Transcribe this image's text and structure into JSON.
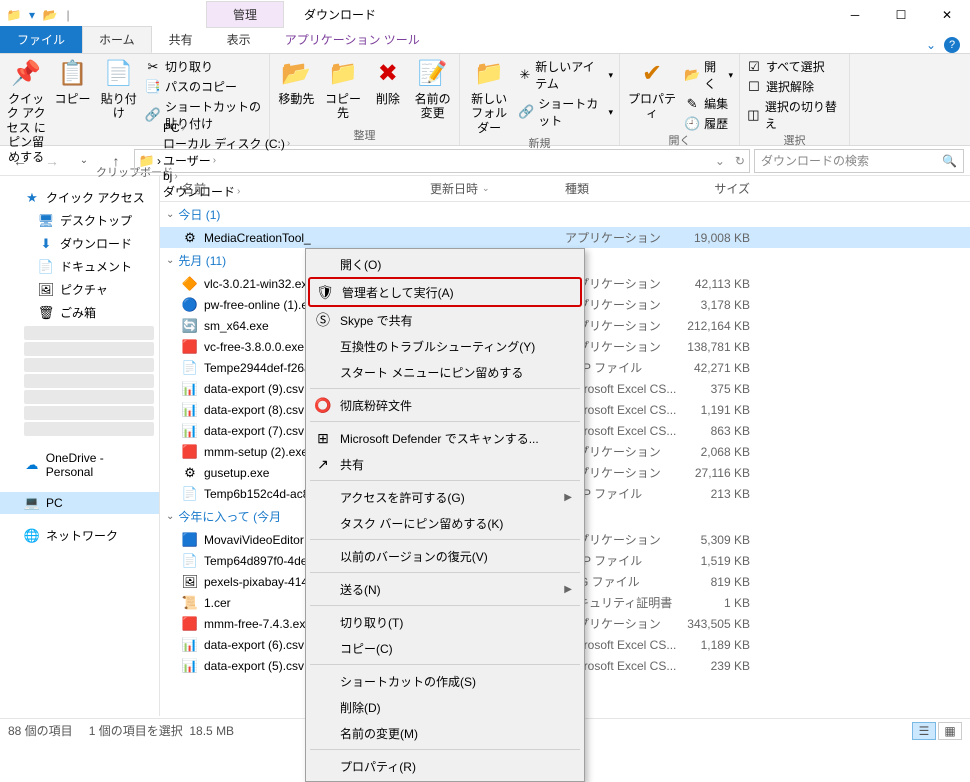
{
  "titlebar": {
    "manage_tab": "管理",
    "title": "ダウンロード"
  },
  "tabs": {
    "file": "ファイル",
    "home": "ホーム",
    "share": "共有",
    "view": "表示",
    "app": "アプリケーション ツール"
  },
  "ribbon": {
    "g1": {
      "pin": "クイック アクセス\nにピン留めする",
      "copy": "コピー",
      "paste": "貼り付け",
      "cut": "切り取り",
      "copypath": "パスのコピー",
      "pastesc": "ショートカットの貼り付け",
      "label": "クリップボード"
    },
    "g2": {
      "move": "移動先",
      "copyto": "コピー先",
      "delete": "削除",
      "rename": "名前の\n変更",
      "label": "整理"
    },
    "g3": {
      "newfolder": "新しい\nフォルダー",
      "newitem": "新しいアイテム",
      "shortcut": "ショートカット",
      "label": "新規"
    },
    "g4": {
      "props": "プロパティ",
      "open": "開く",
      "edit": "編集",
      "history": "履歴",
      "label": "開く"
    },
    "g5": {
      "selall": "すべて選択",
      "selnone": "選択解除",
      "selinv": "選択の切り替え",
      "label": "選択"
    }
  },
  "crumbs": [
    "PC",
    "ローカル ディスク (C:)",
    "ユーザー",
    "bj",
    "ダウンロード"
  ],
  "search_ph": "ダウンロードの検索",
  "cols": {
    "name": "名前",
    "date": "更新日時",
    "type": "種類",
    "size": "サイズ"
  },
  "sidebar": {
    "quick": "クイック アクセス",
    "desktop": "デスクトップ",
    "downloads": "ダウンロード",
    "documents": "ドキュメント",
    "pictures": "ピクチャ",
    "trash": "ごみ箱",
    "onedrive": "OneDrive - Personal",
    "pc": "PC",
    "network": "ネットワーク"
  },
  "groups": {
    "today": {
      "label": "今日",
      "count": "(1)"
    },
    "lastmonth": {
      "label": "先月",
      "count": "(11)"
    },
    "thisyear": {
      "label": "今年に入って (今月",
      "count": ""
    }
  },
  "files": {
    "today": [
      {
        "n": "MediaCreationTool_",
        "t": "アプリケーション",
        "s": "19,008 KB",
        "ic": "⚙",
        "sel": true
      }
    ],
    "lastmonth": [
      {
        "n": "vlc-3.0.21-win32.ex",
        "t": "アプリケーション",
        "s": "42,113 KB",
        "ic": "🔶"
      },
      {
        "n": "pw-free-online (1).e",
        "t": "アプリケーション",
        "s": "3,178 KB",
        "ic": "🔵"
      },
      {
        "n": "sm_x64.exe",
        "t": "アプリケーション",
        "s": "212,164 KB",
        "ic": "🔄"
      },
      {
        "n": "vc-free-3.8.0.0.exe",
        "t": "アプリケーション",
        "s": "138,781 KB",
        "ic": "🟥"
      },
      {
        "n": "Tempe2944def-f26a",
        "t": "EMP ファイル",
        "s": "42,271 KB",
        "ic": "📄"
      },
      {
        "n": "data-export (9).csv",
        "t": "Microsoft Excel CS...",
        "s": "375 KB",
        "ic": "📊"
      },
      {
        "n": "data-export (8).csv",
        "t": "Microsoft Excel CS...",
        "s": "1,191 KB",
        "ic": "📊"
      },
      {
        "n": "data-export (7).csv",
        "t": "Microsoft Excel CS...",
        "s": "863 KB",
        "ic": "📊"
      },
      {
        "n": "mmm-setup (2).exe",
        "t": "アプリケーション",
        "s": "2,068 KB",
        "ic": "🟥"
      },
      {
        "n": "gusetup.exe",
        "t": "アプリケーション",
        "s": "27,116 KB",
        "ic": "⚙"
      },
      {
        "n": "Temp6b152c4d-ac8",
        "t": "EMP ファイル",
        "s": "213 KB",
        "ic": "📄"
      }
    ],
    "thisyear": [
      {
        "n": "MovaviVideoEditor",
        "t": "アプリケーション",
        "s": "5,309 KB",
        "ic": "🟦"
      },
      {
        "n": "Temp64d897f0-4de2",
        "t": "EMP ファイル",
        "s": "1,519 KB",
        "ic": "📄"
      },
      {
        "n": "pexels-pixabay-414",
        "t": "JPG ファイル",
        "s": "819 KB",
        "ic": "🖼"
      },
      {
        "n": "1.cer",
        "t": "セキュリティ証明書",
        "s": "1 KB",
        "ic": "📜"
      },
      {
        "n": "mmm-free-7.4.3.exe",
        "t": "アプリケーション",
        "s": "343,505 KB",
        "ic": "🟥"
      },
      {
        "n": "data-export (6).csv",
        "t": "Microsoft Excel CS...",
        "s": "1,189 KB",
        "ic": "📊"
      },
      {
        "n": "data-export (5).csv",
        "t": "Microsoft Excel CS...",
        "s": "239 KB",
        "ic": "📊"
      }
    ]
  },
  "context": [
    {
      "l": "開く(O)",
      "ic": ""
    },
    {
      "l": "管理者として実行(A)",
      "ic": "🛡",
      "hl": true
    },
    {
      "l": "Skype で共有",
      "ic": "Ⓢ"
    },
    {
      "l": "互換性のトラブルシューティング(Y)",
      "ic": ""
    },
    {
      "l": "スタート メニューにピン留めする",
      "ic": ""
    },
    {
      "sep": true
    },
    {
      "l": "彻底粉碎文件",
      "ic": "⭕"
    },
    {
      "sep": true
    },
    {
      "l": "Microsoft Defender でスキャンする...",
      "ic": "⊞"
    },
    {
      "l": "共有",
      "ic": "↗"
    },
    {
      "sep": true
    },
    {
      "l": "アクセスを許可する(G)",
      "sub": true
    },
    {
      "l": "タスク バーにピン留めする(K)"
    },
    {
      "sep": true
    },
    {
      "l": "以前のバージョンの復元(V)"
    },
    {
      "sep": true
    },
    {
      "l": "送る(N)",
      "sub": true
    },
    {
      "sep": true
    },
    {
      "l": "切り取り(T)"
    },
    {
      "l": "コピー(C)"
    },
    {
      "sep": true
    },
    {
      "l": "ショートカットの作成(S)"
    },
    {
      "l": "削除(D)"
    },
    {
      "l": "名前の変更(M)"
    },
    {
      "sep": true
    },
    {
      "l": "プロパティ(R)"
    }
  ],
  "status": {
    "count": "88 個の項目",
    "sel": "1 個の項目を選択",
    "size": "18.5 MB"
  }
}
